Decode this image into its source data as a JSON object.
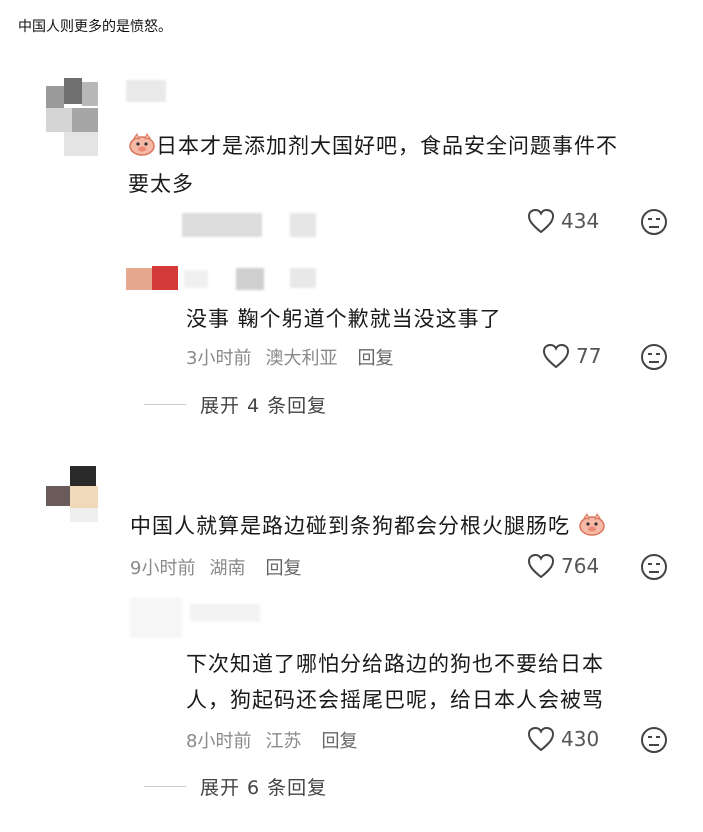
{
  "caption": "中国人则更多的是愤怒。",
  "comments": [
    {
      "text_line1": "日本才是添加剂大国好吧，食品安全问题事件不",
      "text_line2": "要太多",
      "likes": "434",
      "replies": [
        {
          "text": "没事 鞠个躬道个歉就当没这事了",
          "time": "3小时前",
          "location": "澳大利亚",
          "reply_label": "回复",
          "likes": "77"
        }
      ],
      "expand_label": "展开 4 条回复"
    },
    {
      "text": "中国人就算是路边碰到条狗都会分根火腿肠吃",
      "time": "9小时前",
      "location": "湖南",
      "reply_label": "回复",
      "likes": "764",
      "replies": [
        {
          "text_line1": "下次知道了哪怕分给路边的狗也不要给日本",
          "text_line2": "人，狗起码还会摇尾巴呢，给日本人会被骂",
          "time": "8小时前",
          "location": "江苏",
          "reply_label": "回复",
          "likes": "430"
        }
      ],
      "expand_label": "展开 6 条回复"
    }
  ],
  "icons": [
    "heart-icon",
    "dislike-face-icon",
    "emoji-pig-icon"
  ]
}
